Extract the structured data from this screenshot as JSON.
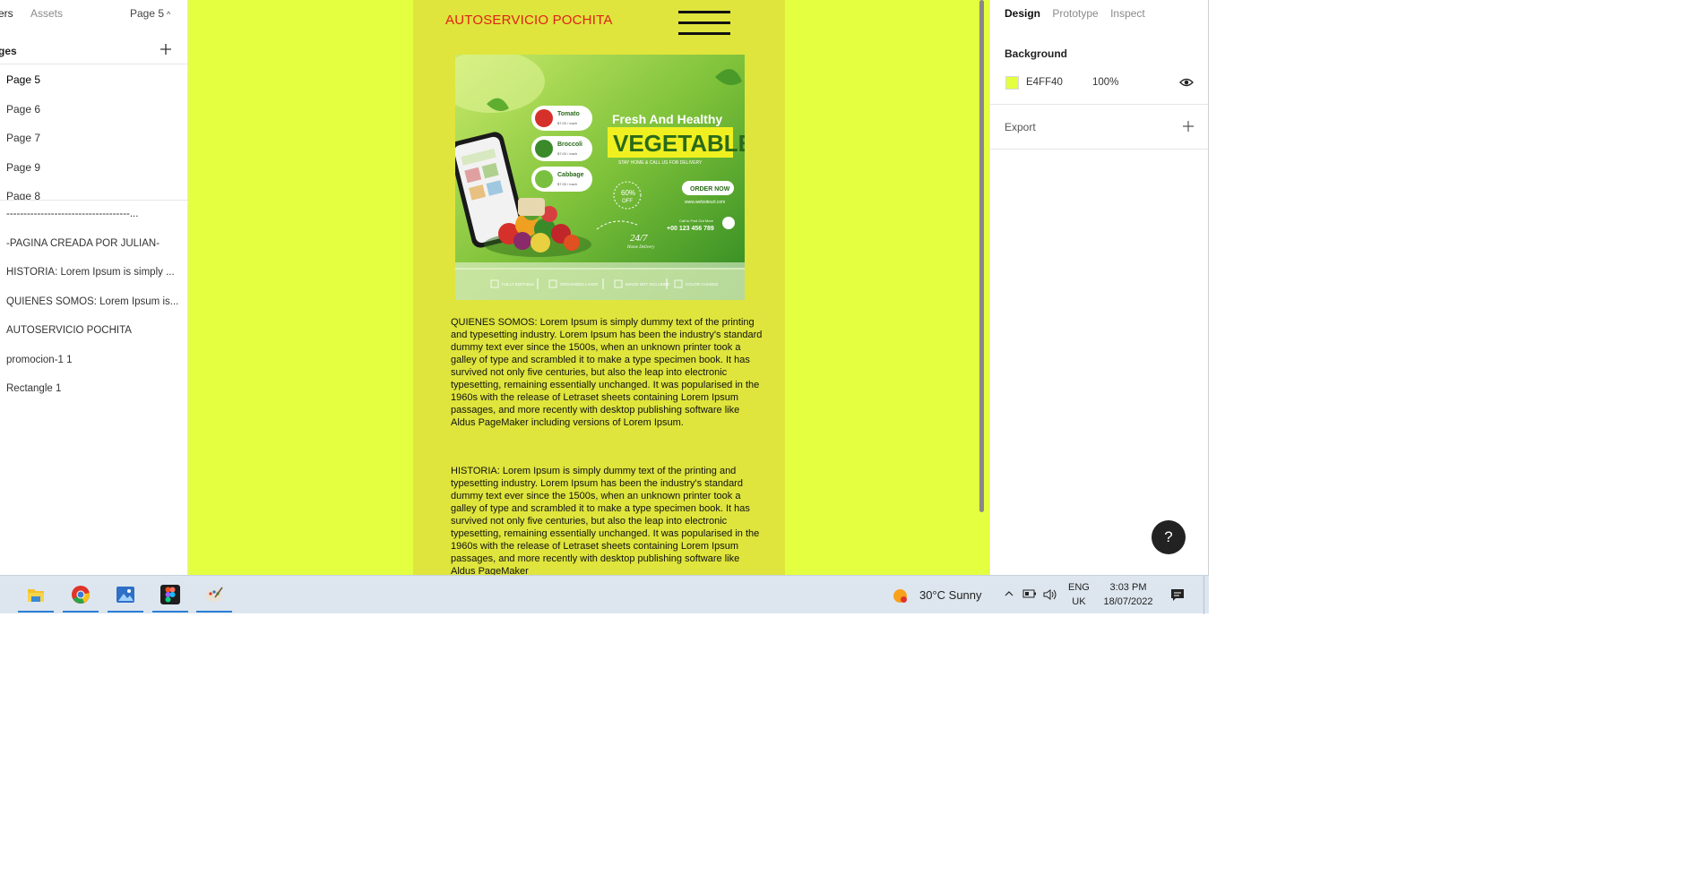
{
  "left_panel": {
    "tabs": {
      "layers": "ers",
      "assets": "Assets"
    },
    "page_selector": "Page 5",
    "pages_title": "ges",
    "pages": [
      "Page 5",
      "Page 6",
      "Page 7",
      "Page 9",
      "Page 8"
    ],
    "layers": [
      "------------------------------------...",
      "-PAGINA CREADA POR JULIAN-",
      "HISTORIA: Lorem Ipsum is simply ...",
      "QUIENES SOMOS: Lorem Ipsum is...",
      "AUTOSERVICIO POCHITA",
      "promocion-1 1",
      "Rectangle 1"
    ]
  },
  "canvas": {
    "background": "#E4FF40",
    "frame_color": "#DFE53C",
    "site_title": "AUTOSERVICIO POCHITA",
    "promo": {
      "headline": "Fresh And Healthy",
      "title": "VEGETABLE",
      "subtitle": "STAY HOME & CALL US FOR DELIVERY",
      "items": [
        {
          "name": "Tomato",
          "price": "$7.00 / each"
        },
        {
          "name": "Broccoli",
          "price": "$7.00 / each"
        },
        {
          "name": "Cabbage",
          "price": "$7.00 / each"
        }
      ],
      "order_button": "ORDER NOW",
      "website": "www.websiteurl.com",
      "discount_value": "60%",
      "discount_label": "OFF",
      "call_label": "Call to Find Out More",
      "phone": "+00 123 456 789",
      "delivery_hours": "24/7",
      "delivery_label": "Home Delivery",
      "features": [
        "FULLY EDITABLE",
        "ORGANIZED LAYER",
        "IMAGE NOT INCLUDED",
        "COLOR CHANGE"
      ]
    },
    "paragraph_quienes": "QUIENES SOMOS: Lorem Ipsum is simply dummy text of the printing and typesetting industry. Lorem Ipsum has been the industry's standard dummy text ever since the 1500s, when an unknown printer took a galley of type and scrambled it to make a type specimen book. It has survived not only five centuries, but also the leap into electronic typesetting, remaining essentially unchanged. It was popularised in the 1960s with the release of Letraset sheets containing Lorem Ipsum passages, and more recently with desktop publishing software like Aldus PageMaker including versions of Lorem Ipsum.",
    "paragraph_historia": "HISTORIA: Lorem Ipsum is simply dummy text of the printing and typesetting industry. Lorem Ipsum has been the industry's standard dummy text ever since the 1500s, when an unknown printer took a galley of type and scrambled it to make a type specimen book. It has survived not only five centuries, but also the leap into electronic typesetting, remaining essentially unchanged. It was popularised in the 1960s with the release of Letraset sheets containing Lorem Ipsum passages, and more recently with desktop publishing software like Aldus PageMaker"
  },
  "right_panel": {
    "tabs": {
      "design": "Design",
      "prototype": "Prototype",
      "inspect": "Inspect"
    },
    "background": {
      "title": "Background",
      "hex": "E4FF40",
      "opacity": "100%",
      "swatch": "#E4FF40"
    },
    "export": {
      "title": "Export"
    },
    "help": "?"
  },
  "taskbar": {
    "apps": [
      "file-explorer-icon",
      "chrome-icon",
      "photos-icon",
      "figma-icon",
      "paint-icon"
    ],
    "weather": "30°C  Sunny",
    "language": {
      "line1": "ENG",
      "line2": "UK"
    },
    "clock": {
      "time": "3:03 PM",
      "date": "18/07/2022"
    }
  }
}
